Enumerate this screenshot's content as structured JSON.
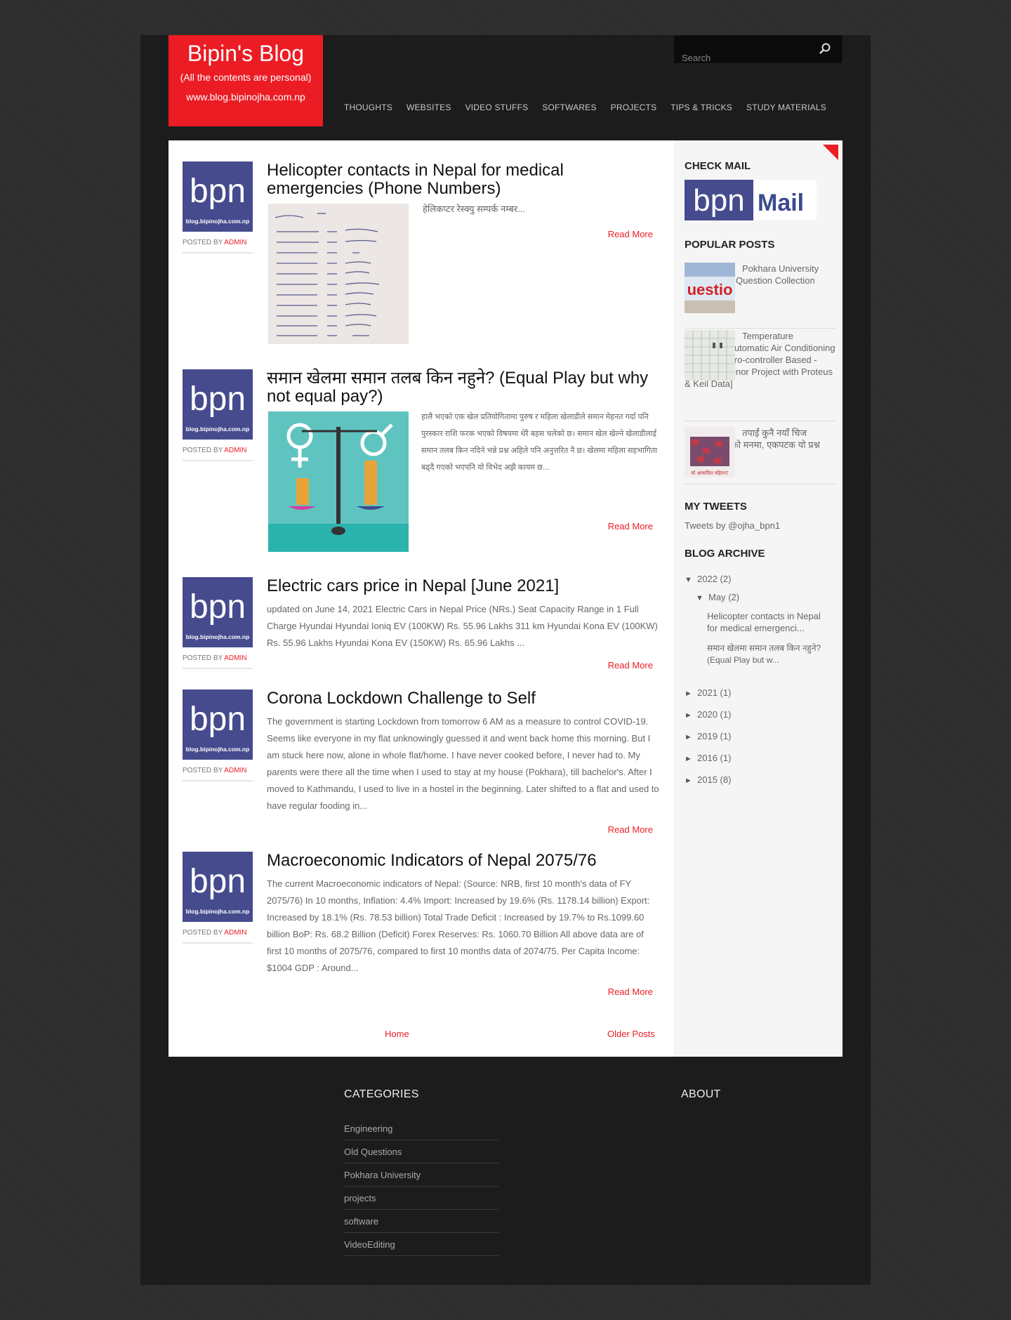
{
  "header": {
    "blog_title": "Bipin's Blog",
    "blog_description": "(All the contents are personal)",
    "blog_url": "www.blog.bipinojha.com.np",
    "search_placeholder": "Search",
    "nav": [
      "THOUGHTS",
      "WEBSITES",
      "VIDEO STUFFS",
      "SOFTWARES",
      "PROJECTS",
      "TIPS & TRICKS",
      "STUDY MATERIALS"
    ]
  },
  "avatar_caption": "blog.bipinojha.com.np",
  "avatar_logo": "bpn",
  "meta": {
    "posted_by": "POSTED BY ",
    "author": "ADMIN"
  },
  "posts": [
    {
      "title": "Helicopter contacts in Nepal for medical emergencies (Phone Numbers)",
      "excerpt": "हेलिकप्टर रेस्क्यु सम्पर्क नम्बर...",
      "more": "Read More"
    },
    {
      "title": "समान खेलमा समान तलब किन नहुने? (Equal Play but why not equal pay?)",
      "excerpt": "हालै भएको एक खेल प्रतियोगितामा पुरुष र महिला खेलाडीले समान मेहनत गर्दा पनि पुरस्कार राशि फरक भएको विषयमा धेरै बहस चलेको छ। समान खेल खेल्ने खेलाडीलाई समान तलब किन नदिने भन्ने प्रश्न अहिले पनि अनुत्तरित नै छ। खेलमा महिला सहभागिता बढ्दै गएको भएपनि यो विभेद अझै कायम छ...",
      "more": "Read More"
    },
    {
      "title": "Electric cars price in Nepal [June 2021]",
      "excerpt": "updated on June 14, 2021 Electric Cars in Nepal Price (NRs.) Seat Capacity Range in 1 Full Charge Hyundai        Hyundai Ioniq EV (100KW) Rs. 55.96 Lakhs            311 km Hyundai Kona EV (100KW) Rs. 55.96 Lakhs      Hyundai Kona EV (150KW) Rs. 65.96 Lakhs ...",
      "more": "Read More"
    },
    {
      "title": "Corona Lockdown Challenge to Self",
      "excerpt": "The government is starting Lockdown from tomorrow 6 AM as a measure to control COVID-19. Seems like everyone in my flat unknowingly guessed it and went back home this morning. But I am stuck here now, alone in whole flat/home. I have never cooked before, I never had to. My parents were there all the time when I used to stay at my house (Pokhara), till bachelor's. After I moved to Kathmandu, I used to live in a hostel in the beginning. Later shifted to a flat and used to have regular fooding in...",
      "more": "Read More"
    },
    {
      "title": "Macroeconomic Indicators of Nepal 2075/76",
      "excerpt": "The current Macroeconomic indicators of Nepal: (Source: NRB, first 10 month's data of FY 2075/76) In 10 months, Inflation: 4.4% Import: Increased by 19.6% (Rs. 1178.14 billion) Export: Increased by 18.1% (Rs. 78.53 billion) Total Trade Deficit : Increased by 19.7% to Rs.1099.60 billion BoP: Rs. 68.2 Billion (Deficit) Forex Reserves: Rs. 1060.70 Billion All above data are of first 10 months of 2075/76, compared to first 10 months data of 2074/75. Per Capita Income: $1004 GDP : Around...",
      "more": "Read More"
    }
  ],
  "pager": {
    "home": "Home",
    "older": "Older Posts"
  },
  "sidebar": {
    "check_mail_title": "CHECK MAIL",
    "mail_logo_text": "bpn",
    "mail_logo_word": "Mail",
    "popular_title": "POPULAR POSTS",
    "popular": [
      "Pokhara University Engineering Question Collection (PU)",
      "Temperature Controlled Automatic Air Conditioning System [Micro-controller Based - Complete Minor Project with Proteus & Keil Data]",
      "तपाईं कुनै नयाँ चिज किन्दा... तपाईंको मनमा, एकपटक यो प्रश्न आएको छ"
    ],
    "popular_img1_text": "uestio",
    "popular_img3_text": "यो आयातित पहिरन?",
    "tweets_title": "MY TWEETS",
    "tweets_text": "Tweets by @ojha_bpn1",
    "archive_title": "BLOG ARCHIVE",
    "archive": {
      "open_year": "2022",
      "open_year_count": "(2)",
      "open_month": "May",
      "open_month_count": "(2)",
      "open_posts": [
        "Helicopter contacts in Nepal for medical emergenci...",
        "समान खेलमा समान तलब किन नहुने? (Equal Play but w..."
      ],
      "years": [
        {
          "year": "2021",
          "count": "(1)"
        },
        {
          "year": "2020",
          "count": "(1)"
        },
        {
          "year": "2019",
          "count": "(1)"
        },
        {
          "year": "2016",
          "count": "(1)"
        },
        {
          "year": "2015",
          "count": "(8)"
        }
      ],
      "expanded_symbol": "▼",
      "collapsed_symbol": "►"
    }
  },
  "footer": {
    "categories_title": "CATEGORIES",
    "about_title": "ABOUT",
    "categories": [
      "Engineering",
      "Old Questions",
      "Pokhara University",
      "projects",
      "software",
      "VideoEditing"
    ]
  },
  "colors": {
    "accent": "#ec1c24",
    "avatar_bg": "#454b8d",
    "page_bg": "#2e2e2e",
    "wrap_bg": "#1c1c1c"
  }
}
